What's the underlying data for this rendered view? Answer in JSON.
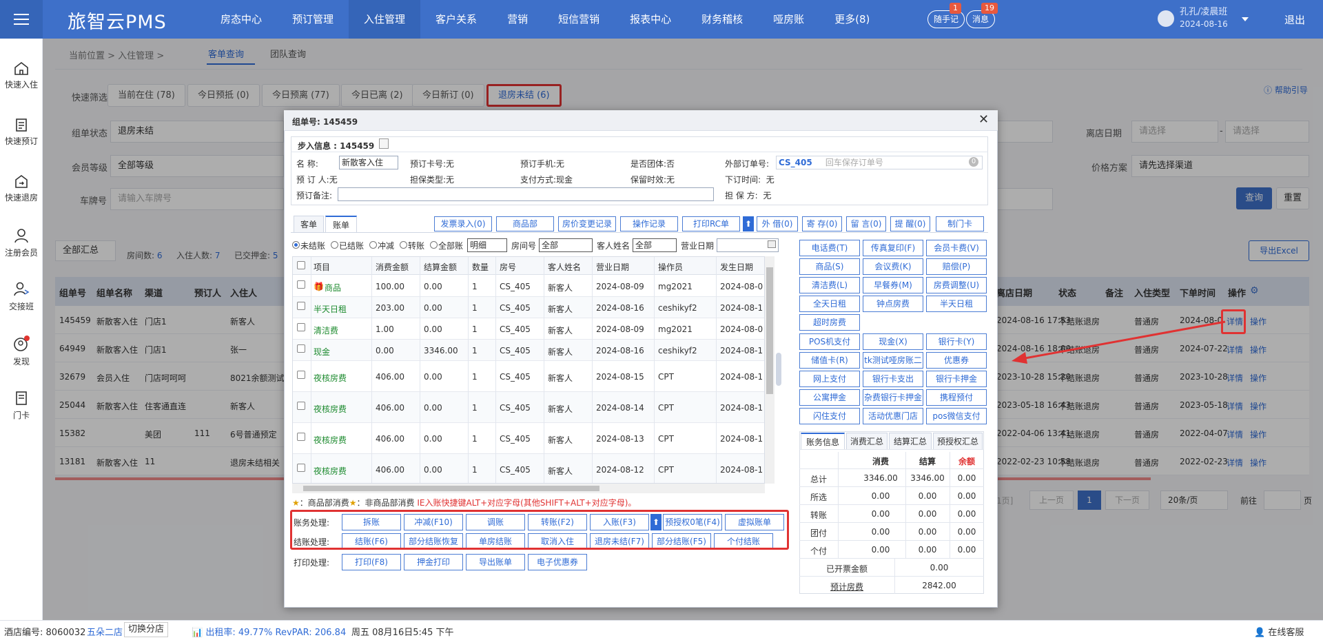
{
  "app": {
    "brand": "旅智云PMS"
  },
  "nav": [
    "房态中心",
    "预订管理",
    "入住管理",
    "客户关系",
    "营销",
    "短信营销",
    "报表中心",
    "财务稽核",
    "哑房账",
    "更多(8)"
  ],
  "header": {
    "notes_label": "随手记",
    "notes_badge": "1",
    "msg_label": "消息",
    "msg_badge": "19",
    "user_name": "孔孔/凌晨班",
    "user_date": "2024-08-16",
    "logout": "退出"
  },
  "sidebar": [
    {
      "label": "快速入住",
      "icon": "home-icon"
    },
    {
      "label": "快速预订",
      "icon": "clipboard-icon"
    },
    {
      "label": "快速退房",
      "icon": "checkout-icon"
    },
    {
      "label": "注册会员",
      "icon": "user-icon"
    },
    {
      "label": "交接班",
      "icon": "shift-icon"
    },
    {
      "label": "发现",
      "icon": "discover-icon"
    },
    {
      "label": "门卡",
      "icon": "card-icon"
    }
  ],
  "breadcrumb": {
    "prefix": "当前位置 > ",
    "current": "入住管理",
    "sep": " >"
  },
  "subtabs": [
    "客单查询",
    "团队查询"
  ],
  "filters": {
    "quick_label": "快速筛选",
    "chips": [
      "当前在住 (78)",
      "今日预抵 (0)",
      "今日预离 (77)",
      "今日已离 (2)",
      "今日新订 (0)",
      "退房未结 (6)"
    ],
    "status_label": "组单状态",
    "status_value": "退房未结",
    "member_label": "会员等级",
    "member_value": "全部等级",
    "plate_label": "车牌号",
    "plate_placeholder": "请输入车牌号",
    "depart_label": "离店日期",
    "depart_from": "请选择",
    "depart_to": "请选择",
    "dash": "-",
    "price_label": "价格方案",
    "price_placeholder": "请先选择渠道",
    "help": "帮助引导",
    "query": "查询",
    "reset": "重置"
  },
  "summary": {
    "scope": "全部汇总",
    "rooms_label": "房间数:",
    "rooms": "6",
    "guests_label": "入住人数:",
    "guests": "7",
    "deposit_label": "已交押金:",
    "deposit": "5",
    "export": "导出Excel"
  },
  "table": {
    "headers_left": [
      "组单号",
      "组单名称",
      "渠道",
      "预订人",
      "入住人"
    ],
    "headers_right": [
      "离店日期",
      "状态",
      "备注",
      "入住类型",
      "下单时间",
      "操作"
    ],
    "rows": [
      {
        "id": "145459",
        "name": "新散客入住",
        "channel": "门店1",
        "booker": "",
        "guest": "新客人",
        "depart": "2024-08-16 17:53",
        "status": "不结账退房",
        "note": "",
        "type": "普通房",
        "order": "2024-08-0",
        "detail": "详情",
        "op": "操作"
      },
      {
        "id": "64949",
        "name": "新散客入住",
        "channel": "门店1",
        "booker": "",
        "guest": "张一",
        "depart": "2024-08-16 18:00",
        "status": "不结账退房",
        "note": "",
        "type": "普通房",
        "order": "2024-07-22",
        "detail": "详情",
        "op": "操作"
      },
      {
        "id": "32679",
        "name": "会员入住",
        "channel": "门店呵呵呵",
        "booker": "",
        "guest": "8021余额测试",
        "depart": "2023-10-28 15:20",
        "status": "不结账退房",
        "note": "",
        "type": "普通房",
        "order": "2023-10-28",
        "detail": "详情",
        "op": "操作"
      },
      {
        "id": "25044",
        "name": "新散客入住",
        "channel": "住客通直连",
        "booker": "",
        "guest": "新客人",
        "depart": "2023-05-18 16:43",
        "status": "不结账退房",
        "note": "",
        "type": "普通房",
        "order": "2023-05-18",
        "detail": "详情",
        "op": "操作"
      },
      {
        "id": "15382",
        "name": "",
        "channel": "美团",
        "booker": "111",
        "guest": "6号普通预定",
        "depart": "2022-04-06 13:41",
        "status": "不结账退房",
        "note": "",
        "type": "普通房",
        "order": "2022-04-07",
        "detail": "详情",
        "op": "操作"
      },
      {
        "id": "13181",
        "name": "新散客入住",
        "channel": "11",
        "booker": "",
        "guest": "退房未结相关",
        "depart": "2022-02-23 10:58",
        "status": "不结账退房",
        "note": "",
        "type": "普通房",
        "order": "2022-02-23",
        "detail": "详情",
        "op": "操作"
      }
    ]
  },
  "pager": {
    "prev": "上一页",
    "page": "1",
    "next": "下一页",
    "size": "20条/页",
    "goto": "前往",
    "unit": "页",
    "total_fragment": "1页]"
  },
  "statusbar": {
    "hotel_label": "酒店编号:",
    "hotel_no": "8060032",
    "branch": "五朵二店",
    "switch": "切换分店",
    "occ": "出租率: 49.77% RevPAR: 206.84",
    "datetime": "周五 08月16日5:45 下午",
    "online": "在线客服"
  },
  "modal": {
    "title_label": "组单号:",
    "title_no": "145459",
    "step_title": "步入信息 : 145459",
    "info": {
      "name_label": "名    称:",
      "name_value": "新散客入住",
      "card_label": "预订卡号:",
      "card_value": "无",
      "phone_label": "预订手机:",
      "phone_value": "无",
      "team_label": "是否团体:",
      "team_value": "否",
      "ext_label": "外部订单号:",
      "ext_value": "CS_405",
      "ext_placeholder": "回车保存订单号",
      "booker_label": "预 订 人:",
      "booker_value": "无",
      "guar_label": "担保类型:",
      "guar_value": "无",
      "pay_label": "支付方式:",
      "pay_value": "现金",
      "keep_label": "保留时效:",
      "keep_value": "无",
      "ordertime_label": "下订时间:",
      "ordertime_value": "无",
      "remark_label": "预订备注:",
      "guarantor_label": "担 保 方:",
      "guarantor_value": "无"
    },
    "tabs": [
      "客单",
      "账单"
    ],
    "toolbar": [
      "发票录入(0)",
      "商品部",
      "房价变更记录",
      "操作记录",
      "打印RC单",
      "外 借(0)",
      "寄 存(0)",
      "留 言(0)",
      "提 醒(0)",
      "制门卡"
    ],
    "filter": {
      "radios": [
        "未结账",
        "已结账",
        "冲减",
        "转账",
        "全部账"
      ],
      "detail": "明细",
      "room_label": "房间号",
      "room_value": "全部",
      "guest_label": "客人姓名",
      "guest_value": "全部",
      "date_label": "营业日期"
    },
    "grid_headers": [
      "项目",
      "消费金额",
      "结算金额",
      "数量",
      "房号",
      "客人姓名",
      "营业日期",
      "操作员",
      "发生日期"
    ],
    "grid_rows": [
      {
        "item": "商品",
        "consume": "100.00",
        "settle": "0.00",
        "qty": "1",
        "room": "CS_405",
        "guest": "新客人",
        "bdate": "2024-08-09",
        "op": "mg2021",
        "odate": "2024-08-0"
      },
      {
        "item": "半天日租",
        "consume": "203.00",
        "settle": "0.00",
        "qty": "1",
        "room": "CS_405",
        "guest": "新客人",
        "bdate": "2024-08-16",
        "op": "ceshikyf2",
        "odate": "2024-08-1"
      },
      {
        "item": "清洁费",
        "consume": "1.00",
        "settle": "0.00",
        "qty": "1",
        "room": "CS_405",
        "guest": "新客人",
        "bdate": "2024-08-09",
        "op": "mg2021",
        "odate": "2024-08-0"
      },
      {
        "item": "现金",
        "consume": "0.00",
        "settle": "3346.00",
        "qty": "1",
        "room": "CS_405",
        "guest": "新客人",
        "bdate": "2024-08-16",
        "op": "ceshikyf2",
        "odate": "2024-08-1"
      },
      {
        "item": "夜核房费",
        "consume": "406.00",
        "settle": "0.00",
        "qty": "1",
        "room": "CS_405",
        "guest": "新客人",
        "bdate": "2024-08-15",
        "op": "CPT",
        "odate": "2024-08-1"
      },
      {
        "item": "夜核房费",
        "consume": "406.00",
        "settle": "0.00",
        "qty": "1",
        "room": "CS_405",
        "guest": "新客人",
        "bdate": "2024-08-14",
        "op": "CPT",
        "odate": "2024-08-1"
      },
      {
        "item": "夜核房费",
        "consume": "406.00",
        "settle": "0.00",
        "qty": "1",
        "room": "CS_405",
        "guest": "新客人",
        "bdate": "2024-08-13",
        "op": "CPT",
        "odate": "2024-08-1"
      },
      {
        "item": "夜核房费",
        "consume": "406.00",
        "settle": "0.00",
        "qty": "1",
        "room": "CS_405",
        "guest": "新客人",
        "bdate": "2024-08-12",
        "op": "CPT",
        "odate": "2024-08-1"
      }
    ],
    "hint_a": "：商品部消费",
    "hint_b": "：非商品部消费 ",
    "hint_red": "IE入账快捷键ALT+对应字母(其他SHIFT+ALT+对应字母)。",
    "acct_label": "账务处理:",
    "acct_buttons": [
      "拆账",
      "冲减(F10)",
      "调账",
      "转账(F2)",
      "入账(F3)",
      "预授权0笔(F4)",
      "虚拟账单"
    ],
    "settle_label": "结账处理:",
    "settle_buttons": [
      "结账(F6)",
      "部分结账恢复",
      "单房结账",
      "取消入住",
      "退房未结(F7)",
      "部分结账(F5)",
      "个付结账"
    ],
    "print_label": "打印处理:",
    "print_buttons": [
      "打印(F8)",
      "押金打印",
      "导出账单",
      "电子优惠券"
    ],
    "charge_buttons": [
      [
        "电话费(T)",
        "传真复印(F)",
        "会员卡费(V)"
      ],
      [
        "商品(S)",
        "会议费(K)",
        "赔偿(P)"
      ],
      [
        "清洁费(L)",
        "早餐券(M)",
        "房费调整(U)"
      ],
      [
        "全天日租",
        "钟点房费",
        "半天日租"
      ],
      [
        "超时房费"
      ]
    ],
    "pay_buttons": [
      [
        "POS机支付",
        "现金(X)",
        "银行卡(Y)"
      ],
      [
        "储值卡(R)",
        "tk测试哑房账二",
        "优惠券"
      ],
      [
        "网上支付",
        "银行卡支出",
        "银行卡押金"
      ],
      [
        "公寓押金",
        "杂费银行卡押金",
        "携程预付"
      ],
      [
        "闪住支付",
        "活动优惠门店",
        "pos微信支付"
      ]
    ],
    "sum_tabs": [
      "账务信息",
      "消费汇总",
      "结算汇总",
      "预授权汇总"
    ],
    "sum_headers": [
      "消费",
      "结算",
      "余额"
    ],
    "sum_rows": [
      {
        "label": "总计",
        "consume": "3346.00",
        "settle": "3346.00",
        "balance": "0.00"
      },
      {
        "label": "所选",
        "consume": "0.00",
        "settle": "0.00",
        "balance": "0.00"
      },
      {
        "label": "转账",
        "consume": "0.00",
        "settle": "0.00",
        "balance": "0.00"
      },
      {
        "label": "团付",
        "consume": "0.00",
        "settle": "0.00",
        "balance": "0.00"
      },
      {
        "label": "个付",
        "consume": "0.00",
        "settle": "0.00",
        "balance": "0.00"
      }
    ],
    "invoiced_label": "已开票金额",
    "invoiced_value": "0.00",
    "expected_label": "预计房费",
    "expected_value": "2842.00"
  },
  "colors": {
    "accent": "#3e70c9",
    "highlight": "#e03232",
    "green_text": "#1c8a2e"
  }
}
